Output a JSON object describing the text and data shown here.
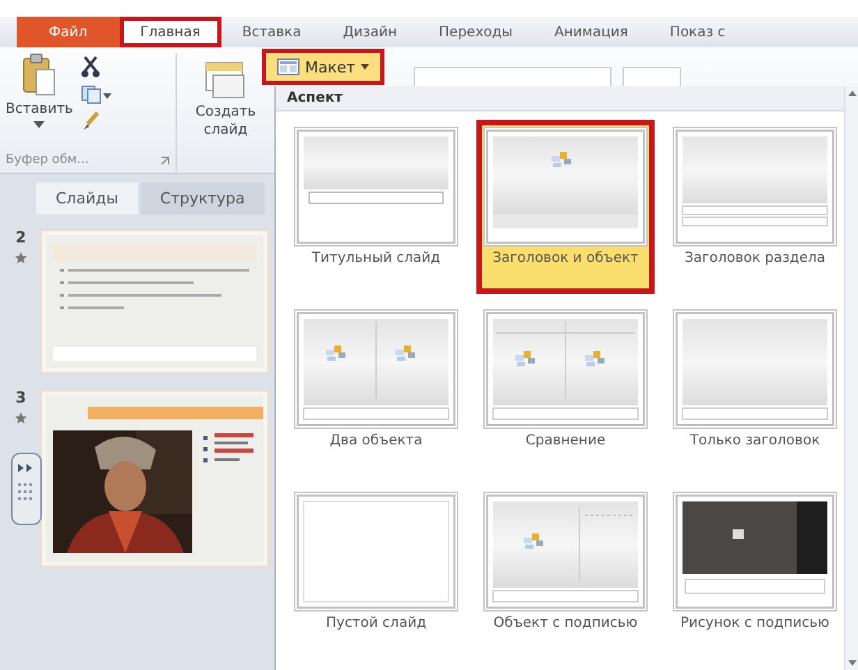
{
  "ribbon_tabs": [
    {
      "label": "Файл",
      "kind": "file",
      "selected": false,
      "highlighted": false
    },
    {
      "label": "Главная",
      "kind": "tab",
      "selected": true,
      "highlighted": true
    },
    {
      "label": "Вставка",
      "kind": "tab",
      "selected": false,
      "highlighted": false
    },
    {
      "label": "Дизайн",
      "kind": "tab",
      "selected": false,
      "highlighted": false
    },
    {
      "label": "Переходы",
      "kind": "tab",
      "selected": false,
      "highlighted": false
    },
    {
      "label": "Анимация",
      "kind": "tab",
      "selected": false,
      "highlighted": false
    },
    {
      "label": "Показ с",
      "kind": "tab",
      "selected": false,
      "highlighted": false
    }
  ],
  "ribbon": {
    "paste_label": "Вставить",
    "new_slide_label": [
      "Создать",
      "слайд"
    ],
    "clipboard_group": "Буфер обм...",
    "layout_button": {
      "label": "Макет",
      "highlighted": true
    }
  },
  "slide_pane": {
    "tabs": [
      {
        "label": "Слайды",
        "selected": true
      },
      {
        "label": "Структура",
        "selected": false
      }
    ],
    "slides": [
      {
        "number": "2",
        "kind": "list"
      },
      {
        "number": "3",
        "kind": "picture"
      }
    ]
  },
  "layout_gallery": {
    "header": "Аспект",
    "layouts": [
      {
        "label": "Титульный слайд",
        "kind": "title",
        "selected": false,
        "highlighted": false
      },
      {
        "label": "Заголовок и объект",
        "kind": "title-content",
        "selected": true,
        "highlighted": true
      },
      {
        "label": "Заголовок раздела",
        "kind": "section",
        "selected": false,
        "highlighted": false
      },
      {
        "label": "Два объекта",
        "kind": "two-content",
        "selected": false,
        "highlighted": false
      },
      {
        "label": "Сравнение",
        "kind": "comparison",
        "selected": false,
        "highlighted": false
      },
      {
        "label": "Только заголовок",
        "kind": "title-only",
        "selected": false,
        "highlighted": false
      },
      {
        "label": "Пустой слайд",
        "kind": "blank",
        "selected": false,
        "highlighted": false
      },
      {
        "label": "Объект с подписью",
        "kind": "content-caption",
        "selected": false,
        "highlighted": false
      },
      {
        "label": "Рисунок с подписью",
        "kind": "picture-caption",
        "selected": false,
        "highlighted": false
      }
    ]
  }
}
